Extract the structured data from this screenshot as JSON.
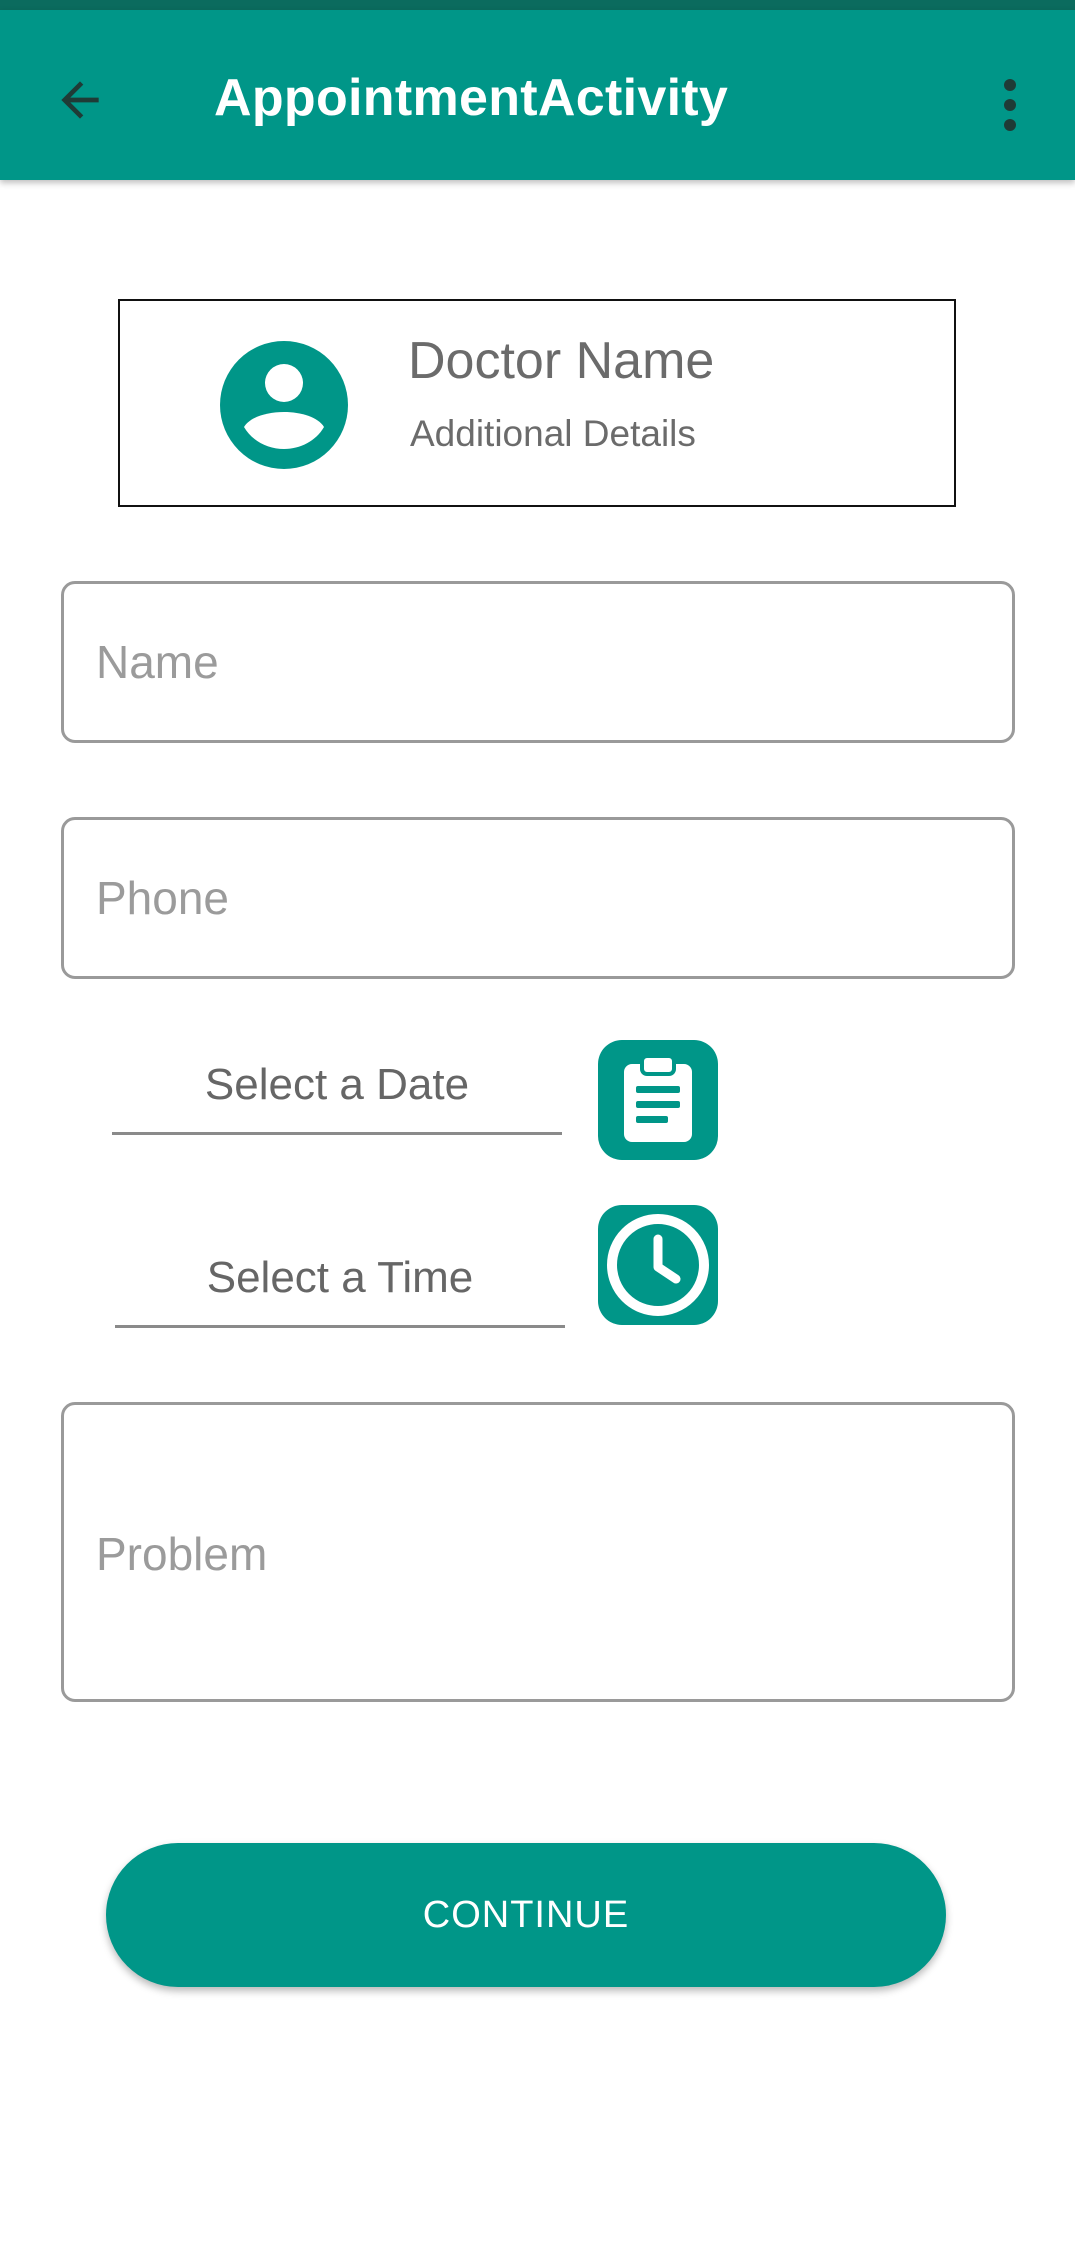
{
  "app_bar": {
    "title": "AppointmentActivity",
    "back_icon": "arrow-back-icon",
    "overflow_icon": "more-vert-icon",
    "background_color": "#009688",
    "status_strip_color": "#0b6b5e"
  },
  "doctor_card": {
    "name": "Doctor Name",
    "details": "Additional Details",
    "avatar_icon": "account-circle-icon"
  },
  "form": {
    "name_placeholder": "Name",
    "phone_placeholder": "Phone",
    "date_label": "Select a Date",
    "date_icon": "clipboard-icon",
    "time_label": "Select a Time",
    "time_icon": "clock-icon",
    "problem_placeholder": "Problem"
  },
  "actions": {
    "continue_label": "CONTINUE"
  },
  "colors": {
    "accent": "#009688",
    "text_secondary": "#6b6b6b",
    "field_border": "#9a9a9a"
  }
}
